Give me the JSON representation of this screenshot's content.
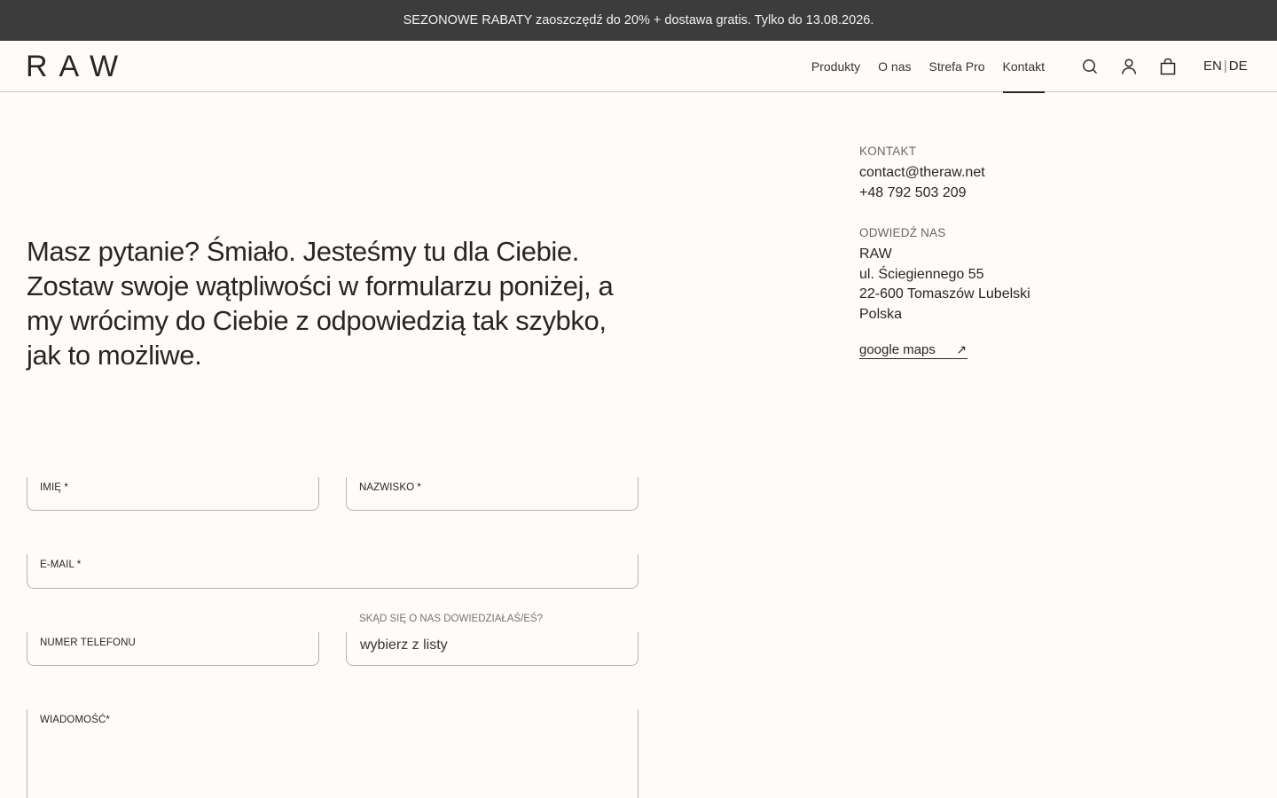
{
  "promo": {
    "text": "SEZONOWE RABATY zaoszczędź do 20% + dostawa gratis. Tylko do 13.08.2026."
  },
  "header": {
    "logo": "RAW",
    "nav": [
      "Produkty",
      "O nas",
      "Strefa Pro",
      "Kontakt"
    ],
    "active_nav": "Kontakt",
    "icons": [
      "search-icon",
      "account-icon",
      "cart-icon"
    ],
    "lang": {
      "en": "EN",
      "separator": "|",
      "de": "DE"
    }
  },
  "main": {
    "heading": "Masz pytanie? Śmiało. Jesteśmy tu dla Ciebie. Zostaw swoje wątpliwości w formularzu poniżej, a my wrócimy do Ciebie z odpowiedzią tak szybko, jak to możliwe."
  },
  "contact": {
    "label": "KONTAKT",
    "email": "contact@theraw.net",
    "phone": "+48 792 503 209"
  },
  "visit": {
    "label": "ODWIEDŹ NAS",
    "lines": [
      "RAW",
      "ul. Ściegiennego 55",
      "22-600 Tomaszów Lubelski",
      "Polska"
    ],
    "maps_link": "google maps"
  },
  "form": {
    "first_name_label": "IMIĘ *",
    "last_name_label": "NAZWISKO *",
    "email_label": "E-MAIL *",
    "phone_label": "NUMER TELEFONU",
    "source_label": "SKĄD SIĘ O NAS DOWIEDZIAŁAŚ/EŚ?",
    "source_value": "wybierz z listy",
    "message_label": "WIADOMOŚĆ*"
  },
  "colors": {
    "promo_bg": "#3c3c3c",
    "page_bg": "#fdfcfb",
    "text": "#2b2520",
    "border": "#b9b3ad"
  }
}
